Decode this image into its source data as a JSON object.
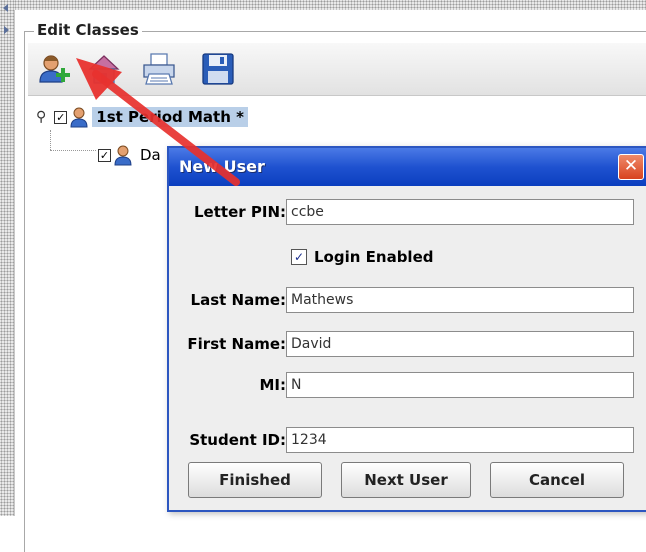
{
  "panel": {
    "title": "Edit Classes"
  },
  "toolbar": {
    "buttons": [
      {
        "name": "add-user-button",
        "icon": "add-user-icon"
      },
      {
        "name": "home-button",
        "icon": "house-icon"
      },
      {
        "name": "print-button",
        "icon": "printer-icon"
      },
      {
        "name": "save-button",
        "icon": "floppy-disk-icon"
      }
    ]
  },
  "tree": {
    "class_node": {
      "label": "1st Period Math *",
      "checked": true
    },
    "student_node": {
      "label": "Da",
      "checked": true
    }
  },
  "dialog": {
    "title": "New User",
    "close_label": "✕",
    "letter_pin": {
      "label": "Letter PIN:",
      "value": "ccbe"
    },
    "login_enabled": {
      "label": "Login Enabled",
      "checked": true
    },
    "last_name": {
      "label": "Last Name:",
      "value": "Mathews"
    },
    "first_name": {
      "label": "First Name:",
      "value": "David"
    },
    "mi": {
      "label": "MI:",
      "value": "N"
    },
    "student_id": {
      "label": "Student ID:",
      "value": "1234"
    },
    "buttons": {
      "finished": "Finished",
      "next_user": "Next User",
      "cancel": "Cancel"
    }
  },
  "colors": {
    "dialog_title_bar": "#1f52d0",
    "selection": "#b9cfe8",
    "annotation_arrow": "#e8312e"
  }
}
